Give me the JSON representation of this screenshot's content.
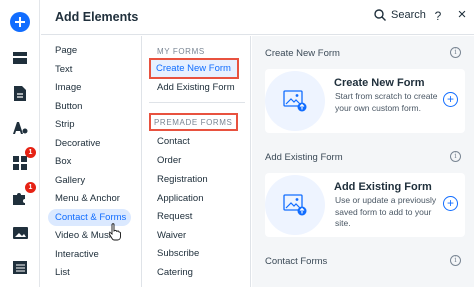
{
  "header": {
    "title": "Add Elements",
    "search_label": "Search",
    "help_glyph": "?",
    "close_glyph": "×"
  },
  "rail": {
    "badges": [
      "1",
      "1"
    ]
  },
  "categories": [
    {
      "label": "Page"
    },
    {
      "label": "Text"
    },
    {
      "label": "Image"
    },
    {
      "label": "Button"
    },
    {
      "label": "Strip"
    },
    {
      "label": "Decorative"
    },
    {
      "label": "Box"
    },
    {
      "label": "Gallery"
    },
    {
      "label": "Menu & Anchor"
    },
    {
      "label": "Contact & Forms"
    },
    {
      "label": "Video & Music"
    },
    {
      "label": "Interactive"
    },
    {
      "label": "List"
    }
  ],
  "sub_sections": {
    "my_forms_label": "MY FORMS",
    "my_forms": [
      "Create New Form",
      "Add Existing Form"
    ],
    "premade_label": "PREMADE FORMS",
    "premade": [
      "Contact",
      "Order",
      "Registration",
      "Application",
      "Request",
      "Waiver",
      "Subscribe",
      "Catering"
    ]
  },
  "content": {
    "groups": [
      {
        "label": "Create New Form",
        "card_title": "Create New Form",
        "card_desc": "Start from scratch to create your own custom form."
      },
      {
        "label": "Add Existing Form",
        "card_title": "Add Existing Form",
        "card_desc": "Use or update a previously saved form to add to your site."
      }
    ],
    "third_label": "Contact Forms",
    "info_glyph": "i",
    "plus_glyph": "+"
  },
  "colors": {
    "accent": "#116dff",
    "highlight_border": "#e8523f",
    "badge": "#e62214",
    "active_bg": "#dbe9ff"
  }
}
